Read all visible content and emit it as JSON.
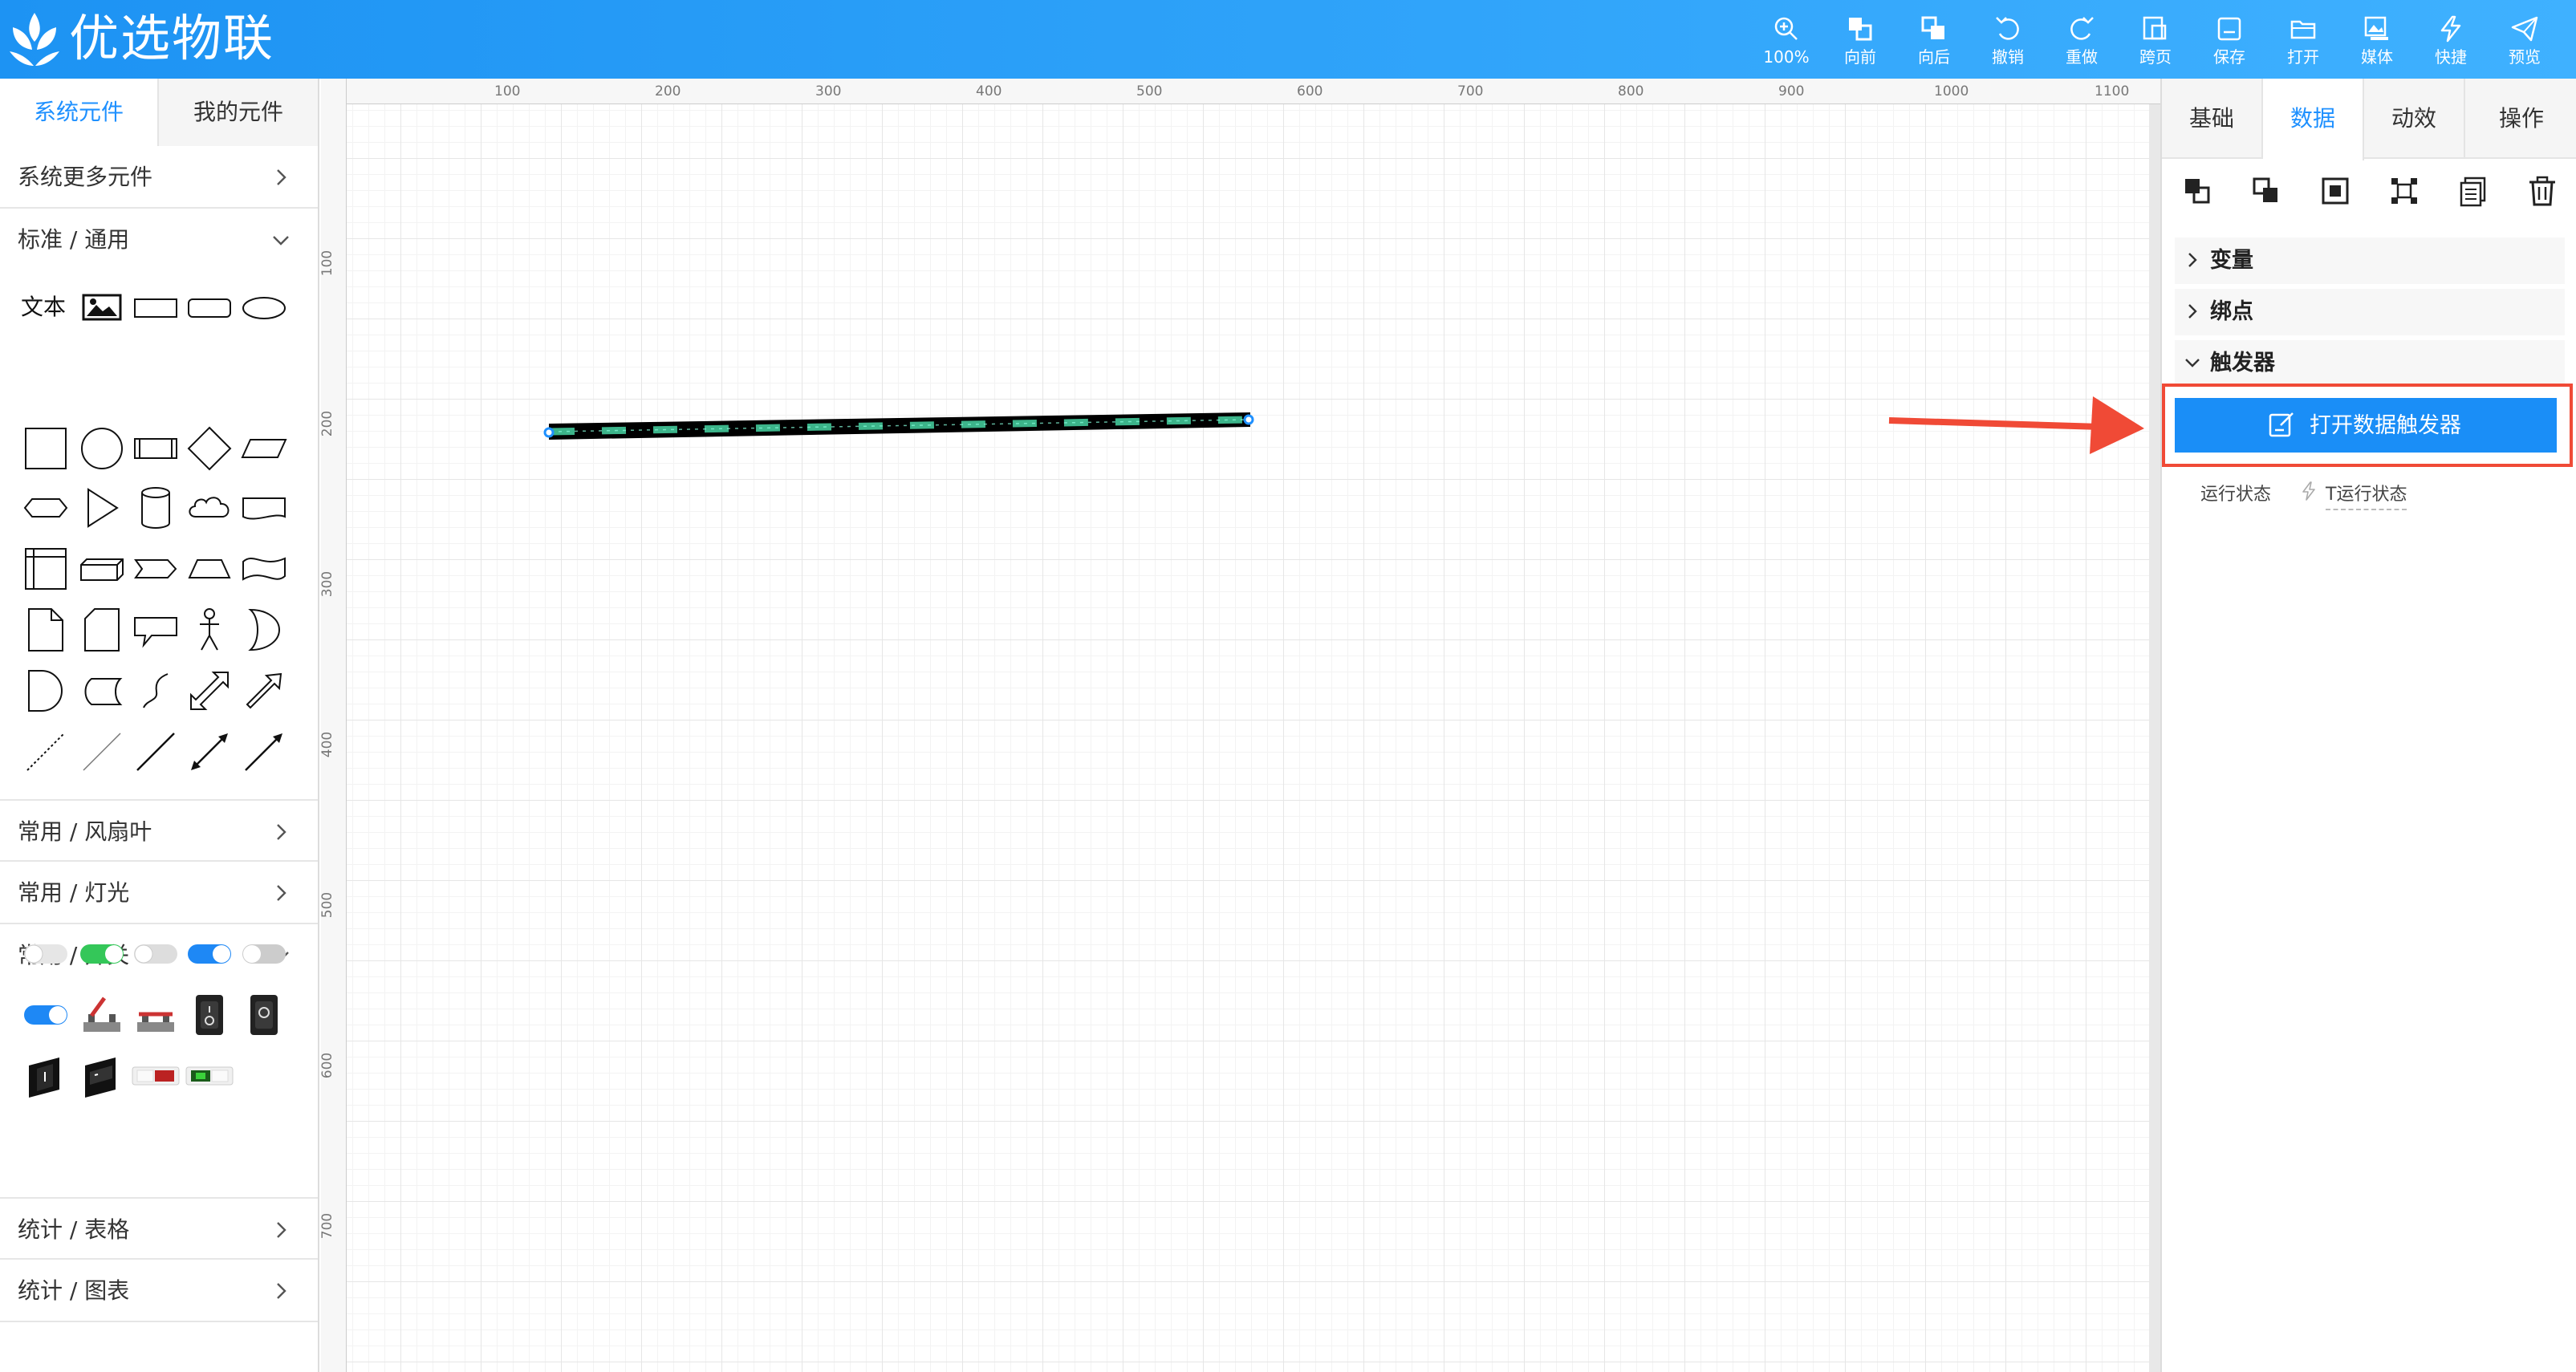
{
  "app": {
    "title": "优选物联"
  },
  "toolbar": [
    {
      "label": "100%",
      "icon": "zoom-in-icon"
    },
    {
      "label": "向前",
      "icon": "bring-forward-icon"
    },
    {
      "label": "向后",
      "icon": "send-backward-icon"
    },
    {
      "label": "撤销",
      "icon": "undo-icon"
    },
    {
      "label": "重做",
      "icon": "redo-icon"
    },
    {
      "label": "跨页",
      "icon": "cross-page-icon"
    },
    {
      "label": "保存",
      "icon": "save-icon"
    },
    {
      "label": "打开",
      "icon": "folder-open-icon"
    },
    {
      "label": "媒体",
      "icon": "media-icon"
    },
    {
      "label": "快捷",
      "icon": "lightning-icon"
    },
    {
      "label": "预览",
      "icon": "send-icon"
    }
  ],
  "left_panel": {
    "tabs": [
      {
        "label": "系统元件",
        "active": true
      },
      {
        "label": "我的元件",
        "active": false
      }
    ],
    "sections": {
      "more": "系统更多元件",
      "standard": "标准 / 通用",
      "fan": "常用 / 风扇叶",
      "light": "常用 / 灯光",
      "switch": "常用 / 开关",
      "table": "统计 / 表格",
      "chart": "统计 / 图表"
    },
    "text_shape": "文本"
  },
  "canvas": {
    "ruler_top": [
      "100",
      "200",
      "300",
      "400",
      "500",
      "600",
      "700",
      "800",
      "900",
      "1000",
      "1100"
    ],
    "ruler_left": [
      "100",
      "200",
      "300",
      "400",
      "500",
      "600",
      "700"
    ],
    "pipe_color": "#3cb48a"
  },
  "right_panel": {
    "tabs": [
      {
        "label": "基础",
        "active": false
      },
      {
        "label": "数据",
        "active": true
      },
      {
        "label": "动效",
        "active": false
      },
      {
        "label": "操作",
        "active": false
      }
    ],
    "accordion": {
      "variables": "变量",
      "binding": "绑点",
      "triggers": "触发器"
    },
    "trigger_button": "打开数据触发器",
    "status_label": "运行状态",
    "status_value": "T运行状态",
    "highlight_color": "#f04a36",
    "accent_color": "#1a8ef7"
  }
}
